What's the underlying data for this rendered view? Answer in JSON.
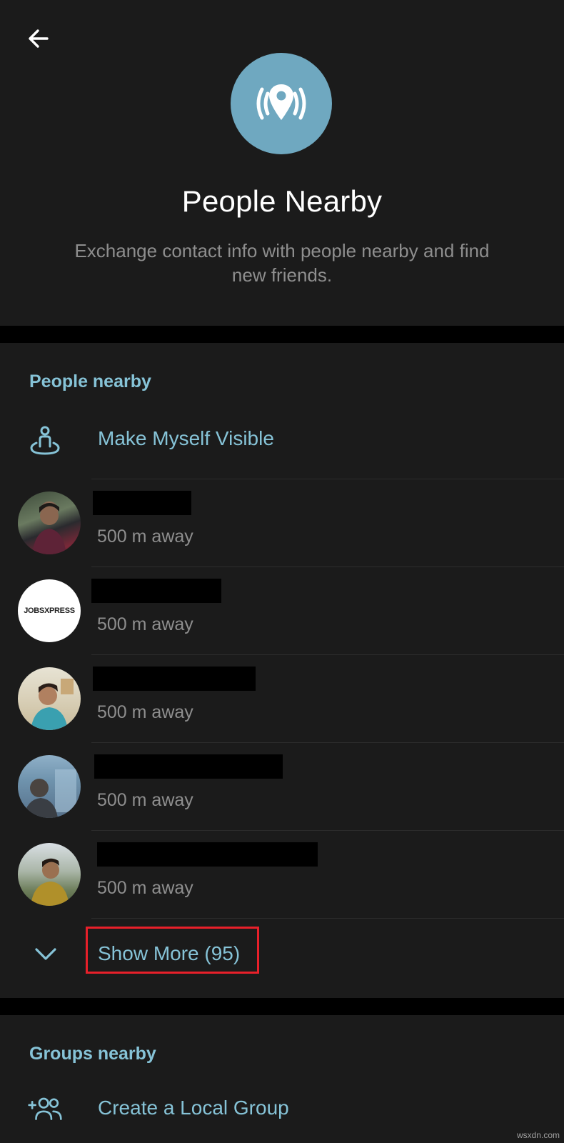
{
  "header": {
    "title": "People Nearby",
    "description": "Exchange contact info with people nearby and find new friends."
  },
  "people_section": {
    "heading": "People nearby",
    "make_visible_label": "Make Myself Visible",
    "people": [
      {
        "distance": "500 m away",
        "name_redacted": true
      },
      {
        "distance": "500 m away",
        "name_redacted": true,
        "avatar_text": "JOBSXPRESS"
      },
      {
        "distance": "500 m away",
        "name_redacted": true
      },
      {
        "distance": "500 m away",
        "name_redacted": true
      },
      {
        "distance": "500 m away",
        "name_redacted": true
      }
    ],
    "show_more_label": "Show More (95)"
  },
  "groups_section": {
    "heading": "Groups nearby",
    "create_group_label": "Create a Local Group"
  },
  "watermark": "wsxdn.com",
  "colors": {
    "background": "#1b1b1b",
    "accent": "#86c3d7",
    "hero_circle": "#6fa8c0",
    "secondary_text": "#8e8e8e",
    "highlight": "#e8202a"
  }
}
